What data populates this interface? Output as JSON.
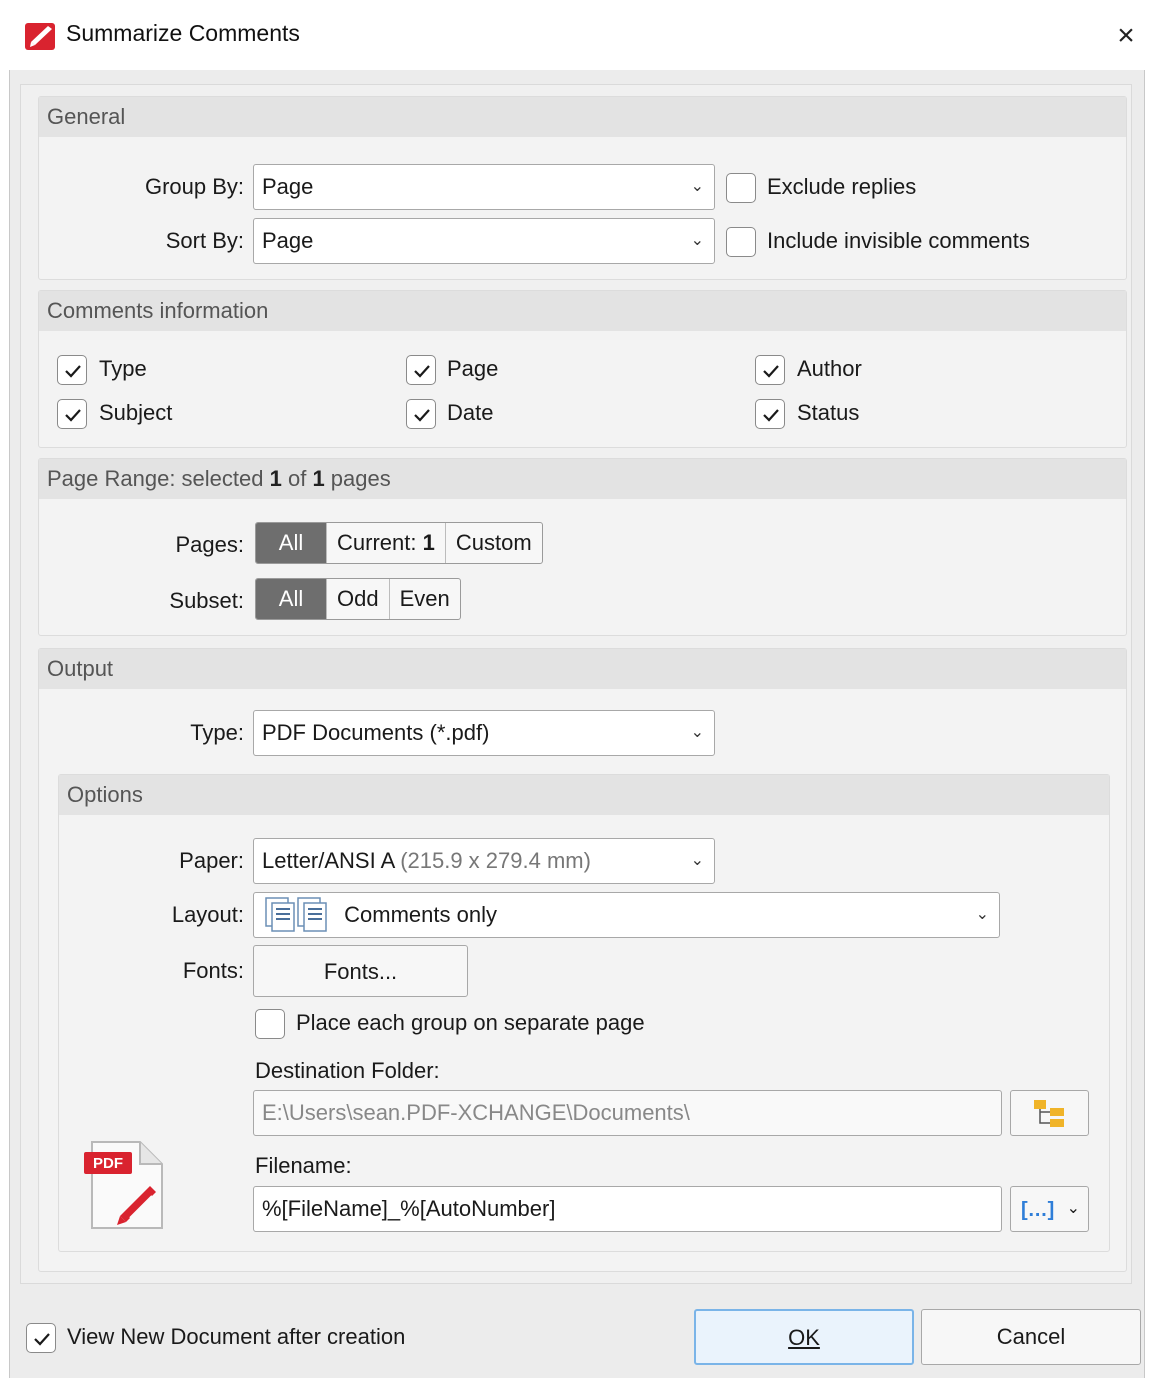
{
  "window": {
    "title": "Summarize Comments",
    "close_glyph": "×"
  },
  "general": {
    "header": "General",
    "group_by_label": "Group By:",
    "group_by_value": "Page",
    "sort_by_label": "Sort By:",
    "sort_by_value": "Page",
    "exclude_replies_label": "Exclude replies",
    "exclude_replies_checked": false,
    "include_invisible_label": "Include invisible comments",
    "include_invisible_checked": false
  },
  "comments_info": {
    "header": "Comments information",
    "items": [
      {
        "label": "Type",
        "checked": true
      },
      {
        "label": "Page",
        "checked": true
      },
      {
        "label": "Author",
        "checked": true
      },
      {
        "label": "Subject",
        "checked": true
      },
      {
        "label": "Date",
        "checked": true
      },
      {
        "label": "Status",
        "checked": true
      }
    ]
  },
  "page_range": {
    "header_prefix": "Page Range: selected ",
    "selected": "1",
    "header_mid": " of ",
    "total": "1",
    "header_suffix": " pages",
    "pages_label": "Pages:",
    "pages_options": [
      "All",
      "Current: ",
      "Custom"
    ],
    "current_page": "1",
    "subset_label": "Subset:",
    "subset_options": [
      "All",
      "Odd",
      "Even"
    ]
  },
  "output": {
    "header": "Output",
    "type_label": "Type:",
    "type_value": "PDF Documents (*.pdf)",
    "options_header": "Options",
    "paper_label": "Paper:",
    "paper_value": "Letter/ANSI A",
    "paper_size": " (215.9 x 279.4 mm)",
    "layout_label": "Layout:",
    "layout_value": "Comments only",
    "fonts_label": "Fonts:",
    "fonts_button": "Fonts...",
    "separate_page_label": "Place each group on separate page",
    "separate_page_checked": false,
    "dest_folder_label": "Destination Folder:",
    "dest_folder_value": "E:\\Users\\sean.PDF-XCHANGE\\Documents\\",
    "filename_label": "Filename:",
    "filename_value": "%[FileName]_%[AutoNumber]",
    "pdf_badge": "PDF",
    "macro_glyph": "[…]"
  },
  "footer": {
    "view_new_label": "View New Document after creation",
    "view_new_checked": true,
    "ok_label": "OK",
    "cancel_label": "Cancel"
  },
  "colors": {
    "accent": "#0078d7",
    "brand": "#d9232f",
    "ok_border": "#7ab4e8"
  }
}
